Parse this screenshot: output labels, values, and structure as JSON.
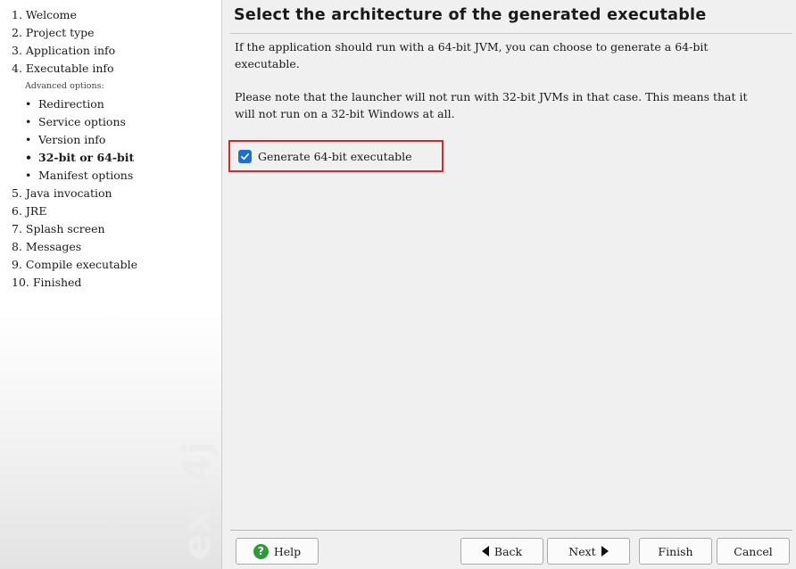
{
  "sidebar": {
    "steps": [
      {
        "label": "1. Welcome"
      },
      {
        "label": "2. Project type"
      },
      {
        "label": "3. Application info"
      },
      {
        "label": "4. Executable info"
      }
    ],
    "advanced_label": "Advanced options:",
    "sub_steps": [
      {
        "label": "Redirection"
      },
      {
        "label": "Service options"
      },
      {
        "label": "Version info"
      },
      {
        "label": "32-bit or 64-bit"
      },
      {
        "label": "Manifest options"
      }
    ],
    "steps_after": [
      {
        "label": "5. Java invocation"
      },
      {
        "label": "6. JRE"
      },
      {
        "label": "7. Splash screen"
      },
      {
        "label": "8. Messages"
      },
      {
        "label": "9. Compile executable"
      },
      {
        "label": "10. Finished"
      }
    ],
    "bullet": "•",
    "watermark": "exe4j"
  },
  "main": {
    "title": "Select the architecture of the generated executable",
    "paragraph1": "If the application should run with a 64-bit JVM, you can choose to generate a 64-bit executable.",
    "paragraph2": "Please note that the launcher will not run with 32-bit JVMs in that case. This means that it will not run on a 32-bit Windows at all.",
    "checkbox": {
      "label": "Generate 64-bit executable",
      "checked": true
    }
  },
  "buttons": {
    "help": "Help",
    "back": "Back",
    "next": "Next",
    "finish": "Finish",
    "cancel": "Cancel"
  },
  "colors": {
    "checkbox": "#1f6fd1",
    "highlight_border": "#d9262d",
    "help_icon": "#2e9a3a"
  }
}
